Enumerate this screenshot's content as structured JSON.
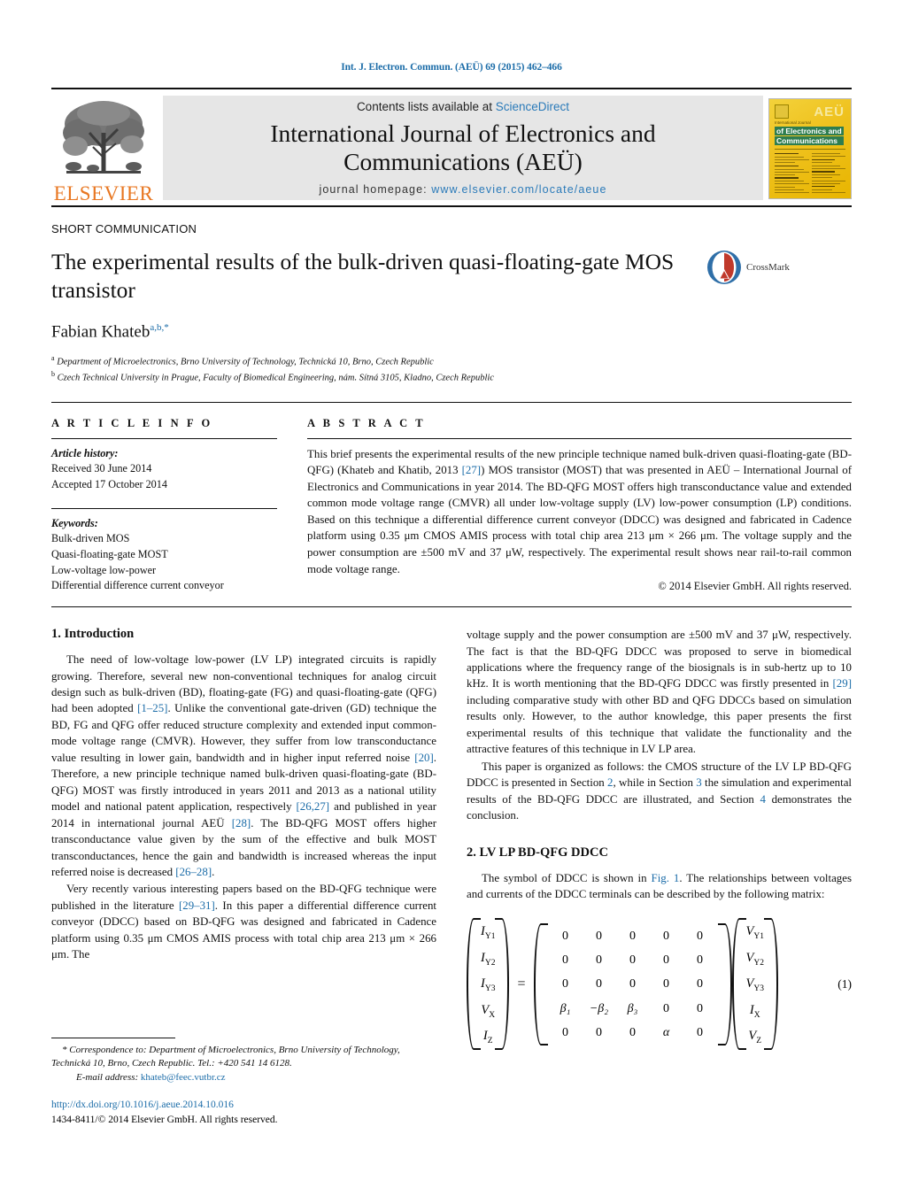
{
  "running_head": "Int. J. Electron. Commun. (AEÜ) 69 (2015) 462–466",
  "masthead": {
    "contents_prefix": "Contents lists available at ",
    "sciencedirect": "ScienceDirect",
    "journal_title_line1": "International Journal of Electronics and",
    "journal_title_line2": "Communications (AEÜ)",
    "homepage_label": "journal homepage: ",
    "homepage_url": "www.elsevier.com/locate/aeue",
    "publisher_wordmark": "ELSEVIER",
    "cover": {
      "aeu_mark": "AEÜ",
      "kicker": "International Journal",
      "line1": "of Electronics and",
      "line2": "Communications"
    }
  },
  "article": {
    "type_label": "SHORT COMMUNICATION",
    "title": "The experimental results of the bulk-driven quasi-floating-gate MOS transistor",
    "crossmark_label": "CrossMark",
    "author": "Fabian Khateb",
    "affiliation_a": "Department of Microelectronics, Brno University of Technology, Technická 10, Brno, Czech Republic",
    "affiliation_b": "Czech Technical University in Prague, Faculty of Biomedical Engineering, nám. Sítná 3105, Kladno, Czech Republic"
  },
  "info": {
    "heading": "A R T I C L E    I N F O",
    "history_label": "Article history:",
    "history_received": "Received 30 June 2014",
    "history_accepted": "Accepted 17 October 2014",
    "keywords_label": "Keywords:",
    "keywords": [
      "Bulk-driven MOS",
      "Quasi-floating-gate MOST",
      "Low-voltage low-power",
      "Differential difference current conveyor"
    ]
  },
  "abstract": {
    "heading": "A B S T R A C T",
    "part1": "This brief presents the experimental results of the new principle technique named bulk-driven quasi-floating-gate (BD-QFG) (Khateb and Khatib, 2013 ",
    "ref1": "[27]",
    "part2": ") MOS transistor (MOST) that was presented in AEÜ – International Journal of Electronics and Communications in year 2014. The BD-QFG MOST offers high transconductance value and extended common mode voltage range (CMVR) all under low-voltage supply (LV) low-power consumption (LP) conditions. Based on this technique a differential difference current conveyor (DDCC) was designed and fabricated in Cadence platform using 0.35 μm CMOS AMIS process with total chip area 213 μm × 266 μm. The voltage supply and the power consumption are ±500 mV and 37 μW, respectively. The experimental result shows near rail-to-rail common mode voltage range.",
    "copyright": "© 2014 Elsevier GmbH. All rights reserved."
  },
  "sections": {
    "intro_heading": "1.  Introduction",
    "intro_p1_a": "The need of low-voltage low-power (LV LP) integrated circuits is rapidly growing. Therefore, several new non-conventional techniques for analog circuit design such as bulk-driven (BD), floating-gate (FG) and quasi-floating-gate (QFG) had been adopted ",
    "intro_p1_ref": "[1–25]",
    "intro_p1_b": ". Unlike the conventional gate-driven (GD) technique the BD, FG and QFG offer reduced structure complexity and extended input common-mode voltage range (CMVR). However, they suffer from low transconductance value resulting in lower gain, bandwidth and in higher input referred noise ",
    "intro_p1_ref2": "[20]",
    "intro_p1_c": ". Therefore, a new principle technique named bulk-driven quasi-floating-gate (BD-QFG) MOST was firstly introduced in years 2011 and 2013 as a national utility model and national patent application, respectively ",
    "intro_p1_ref3": "[26,27]",
    "intro_p1_d": " and published in year 2014 in international journal AEÜ ",
    "intro_p1_ref4": "[28]",
    "intro_p1_e": ". The BD-QFG MOST offers higher transconductance value given by the sum of the effective and bulk MOST transconductances, hence the gain and bandwidth is increased whereas the input referred noise is decreased ",
    "intro_p1_ref5": "[26–28]",
    "intro_p1_f": ".",
    "intro_p2_a": "Very recently various interesting papers based on the BD-QFG technique were published in the literature ",
    "intro_p2_ref": "[29–31]",
    "intro_p2_b": ". In this paper a differential difference current conveyor (DDCC) based on BD-QFG was designed and fabricated in Cadence platform using 0.35 μm CMOS AMIS process with total chip area 213 μm × 266 μm. The ",
    "right_p1_a": "voltage supply and the power consumption are ±500 mV and 37 μW, respectively. The fact is that the BD-QFG DDCC was proposed to serve in biomedical applications where the frequency range of the biosignals is in sub-hertz up to 10 kHz. It is worth mentioning that the BD-QFG DDCC was firstly presented in ",
    "right_p1_ref": "[29]",
    "right_p1_b": " including comparative study with other BD and QFG DDCCs based on simulation results only. However, to the author knowledge, this paper presents the first experimental results of this technique that validate the functionality and the attractive features of this technique in LV LP area.",
    "right_p2_a": "This paper is organized as follows: the CMOS structure of the LV LP BD-QFG DDCC is presented in Section ",
    "right_p2_ref1": "2",
    "right_p2_b": ", while in Section ",
    "right_p2_ref2": "3",
    "right_p2_c": " the simulation and experimental results of the BD-QFG DDCC are illustrated, and Section ",
    "right_p2_ref3": "4",
    "right_p2_d": " demonstrates the conclusion.",
    "sec2_heading": "2.  LV LP BD-QFG DDCC",
    "sec2_p1_a": "The symbol of DDCC is shown in ",
    "sec2_p1_ref": "Fig. 1",
    "sec2_p1_b": ". The relationships between voltages and currents of the DDCC terminals can be described by the following matrix:"
  },
  "equation": {
    "number": "(1)",
    "lhs": [
      "I",
      "I",
      "I",
      "V",
      "I"
    ],
    "lhs_sub": [
      "Y1",
      "Y2",
      "Y3",
      "X",
      "Z"
    ],
    "matrix": [
      [
        "0",
        "0",
        "0",
        "0",
        "0"
      ],
      [
        "0",
        "0",
        "0",
        "0",
        "0"
      ],
      [
        "0",
        "0",
        "0",
        "0",
        "0"
      ],
      [
        "β₁",
        "−β₂",
        "β₃",
        "0",
        "0"
      ],
      [
        "0",
        "0",
        "0",
        "α",
        "0"
      ]
    ],
    "rhs": [
      "V",
      "V",
      "V",
      "I",
      "V"
    ],
    "rhs_sub": [
      "Y1",
      "Y2",
      "Y3",
      "X",
      "Z"
    ],
    "equals": "="
  },
  "footnote": {
    "marker": "*",
    "correspondence": " Correspondence to: Department of Microelectronics, Brno University of Technology, Technická 10, Brno, Czech Republic. Tel.: +420 541 14 6128.",
    "email_label": "E-mail address:",
    "email": "khateb@feec.vutbr.cz",
    "doi": "http://dx.doi.org/10.1016/j.aeue.2014.10.016",
    "issn_line": "1434-8411/© 2014 Elsevier GmbH. All rights reserved."
  },
  "colors": {
    "link": "#1b6ca8",
    "elsevier_orange": "#E87722",
    "band_gray": "#e6e6e6"
  }
}
